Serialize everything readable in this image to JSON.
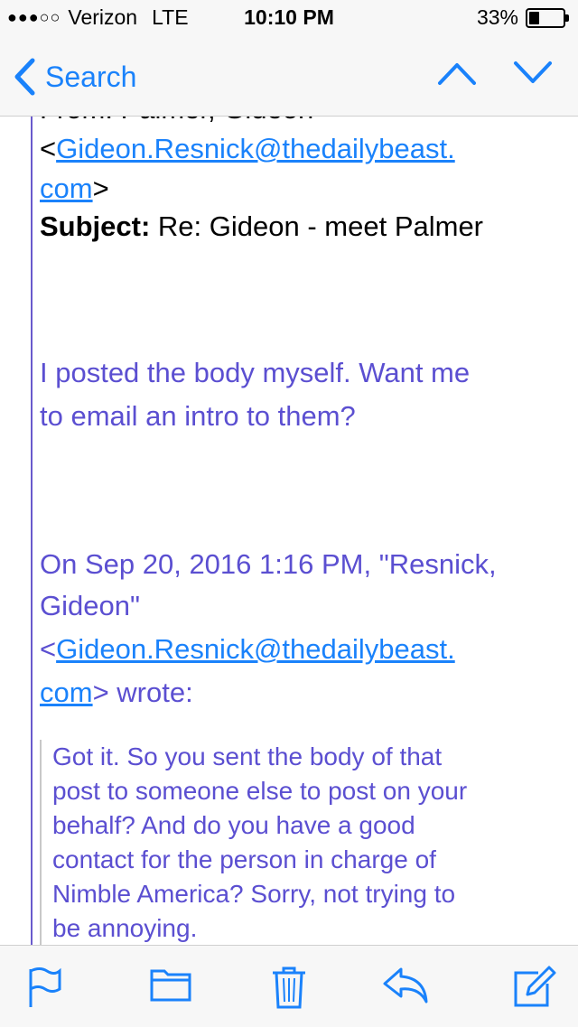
{
  "status_bar": {
    "carrier": "Verizon",
    "network": "LTE",
    "time": "10:10 PM",
    "battery_percent": "33%",
    "battery_level": 0.33
  },
  "nav": {
    "back_label": "Search"
  },
  "email": {
    "from_clipped": "From: Palmer, Gideon",
    "to_open": "<",
    "to_link_part1": "Gideon.Resnick@thedailybeast.",
    "to_link_part2": "com",
    "to_close": ">",
    "subject_label": "Subject:",
    "subject_value": "Re: Gideon - meet Palmer",
    "body_line1": "I posted the body myself. Want me",
    "body_line2": "to email an intro to them?",
    "attribution_line1": "On Sep 20, 2016 1:16 PM, \"Resnick,",
    "attribution_line2": "Gideon\"",
    "attribution_open": "<",
    "attribution_link_part1": "Gideon.Resnick@thedailybeast.",
    "attribution_link_part2": "com",
    "attribution_tail": "> wrote:",
    "quoted_lines": [
      "Got it. So you sent the body of that",
      "post to someone else to post on your",
      "behalf? And do you have a good",
      "contact for the person in charge of",
      "Nimble America? Sorry, not trying to",
      "be annoying."
    ]
  },
  "toolbar": {
    "icons": [
      "flag-icon",
      "folder-icon",
      "trash-icon",
      "reply-icon",
      "compose-icon"
    ]
  },
  "colors": {
    "accent": "#1a82fb",
    "quoted_text": "#5b4fd1"
  }
}
